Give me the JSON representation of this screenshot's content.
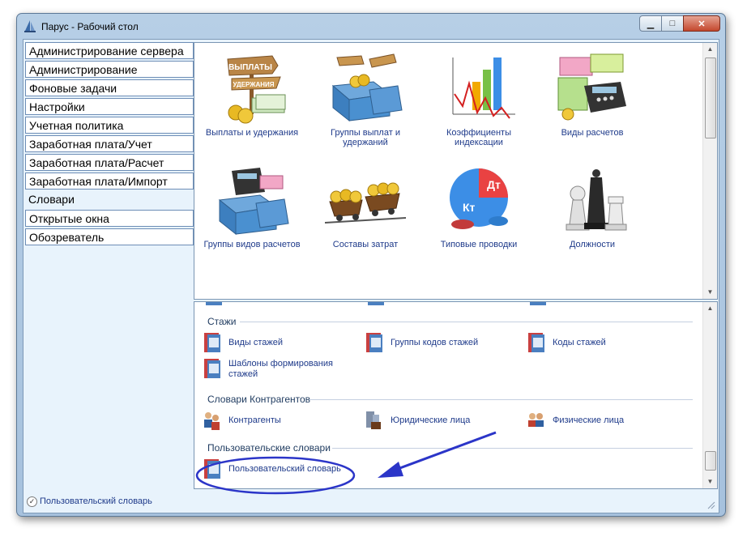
{
  "window": {
    "title": "Парус - Рабочий стол"
  },
  "nav": {
    "items": [
      {
        "label": "Администрирование сервера"
      },
      {
        "label": "Администрирование"
      },
      {
        "label": "Фоновые задачи"
      },
      {
        "label": "Настройки"
      },
      {
        "label": "Учетная политика"
      },
      {
        "label": "Заработная плата/Учет"
      },
      {
        "label": "Заработная плата/Расчет"
      },
      {
        "label": "Заработная плата/Импорт"
      },
      {
        "label": "Словари"
      },
      {
        "label": "Открытые окна"
      },
      {
        "label": "Обозреватель"
      }
    ],
    "active": "Словари"
  },
  "top_icons": [
    {
      "label": "Выплаты и удержания",
      "icon": "payments-signpost-icon"
    },
    {
      "label": "Группы выплат и удержаний",
      "icon": "payment-groups-box-icon"
    },
    {
      "label": "Коэффициенты индексации",
      "icon": "index-chart-icon"
    },
    {
      "label": "Виды расчетов",
      "icon": "calculator-money-icon"
    },
    {
      "label": "Группы видов расчетов",
      "icon": "calc-groups-box-icon"
    },
    {
      "label": "Составы затрат",
      "icon": "coin-carts-icon"
    },
    {
      "label": "Типовые проводки",
      "icon": "debit-credit-pie-icon"
    },
    {
      "label": "Должности",
      "icon": "chess-pieces-icon"
    }
  ],
  "sections": {
    "stazhi": {
      "title": "Стажи",
      "items": [
        "Виды стажей",
        "Группы кодов стажей",
        "Коды стажей",
        "Шаблоны формирования стажей"
      ]
    },
    "contragents": {
      "title": "Словари Контрагентов",
      "items": [
        "Контрагенты",
        "Юридические лица",
        "Физические лица"
      ]
    },
    "user_dicts": {
      "title": "Пользовательские словари",
      "items": [
        "Пользовательский словарь"
      ]
    }
  },
  "status": {
    "text": "Пользовательский словарь"
  },
  "colors": {
    "annotation": "#2b35c8",
    "link": "#1e3a8a",
    "nav_border": "#6d8db6"
  }
}
